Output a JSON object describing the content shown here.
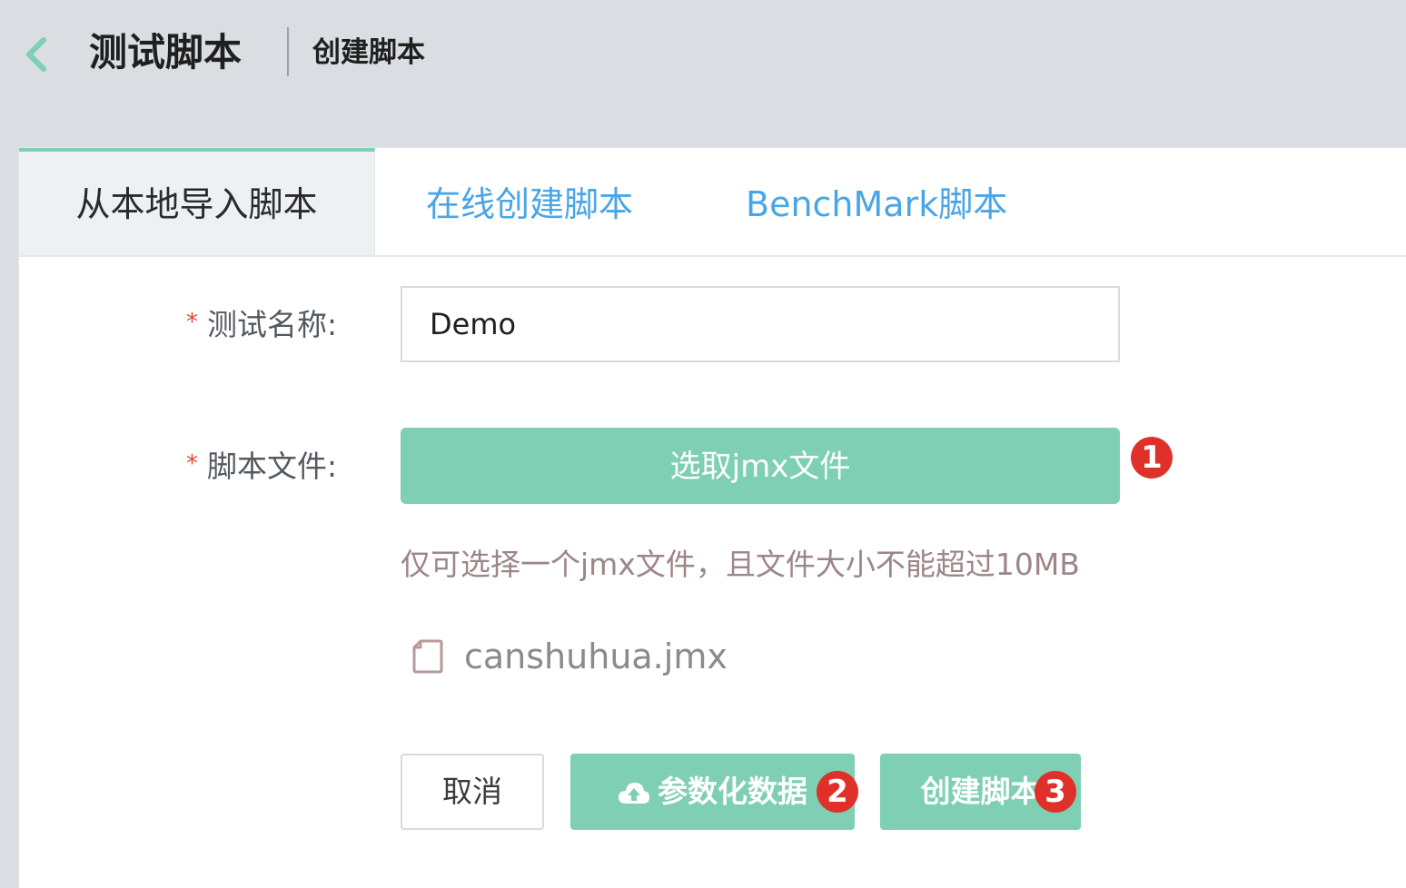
{
  "header": {
    "title": "测试脚本",
    "subtitle": "创建脚本",
    "back_icon": "chevron-left-icon",
    "accent_color": "#7ecfb3"
  },
  "tabs": [
    {
      "label": "从本地导入脚本",
      "active": true
    },
    {
      "label": "在线创建脚本",
      "active": false
    },
    {
      "label": "BenchMark脚本",
      "active": false
    }
  ],
  "form": {
    "required_mark": "*",
    "name_label": "测试名称:",
    "name_value": "Demo",
    "file_label": "脚本文件:",
    "select_file_label": "选取jmx文件",
    "hint": "仅可选择一个jmx文件，且文件大小不能超过10MB",
    "file_icon": "file-icon",
    "file_name": "canshuhua.jmx"
  },
  "actions": {
    "cancel_label": "取消",
    "param_label": "参数化数据",
    "param_icon": "cloud-upload-icon",
    "create_label": "创建脚本"
  },
  "badges": {
    "one": "1",
    "two": "2",
    "three": "3",
    "color": "#e0302a"
  }
}
